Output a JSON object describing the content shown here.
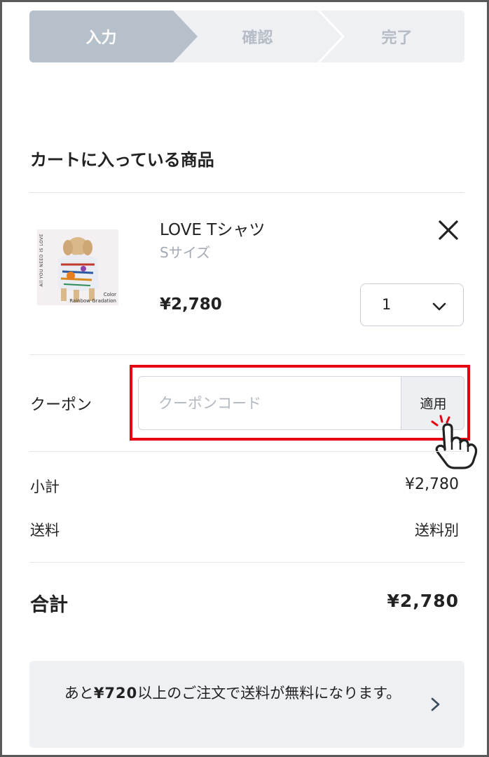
{
  "stepper": {
    "steps": [
      {
        "label": "入力",
        "active": true
      },
      {
        "label": "確認",
        "active": false
      },
      {
        "label": "完了",
        "active": false
      }
    ],
    "active_color": "#b6c0cb",
    "inactive_color": "#eef0f3"
  },
  "cart": {
    "title": "カートに入っている商品",
    "item": {
      "name": "LOVE Tシャツ",
      "size": "Sサイズ",
      "price": "¥2,780",
      "quantity": "1",
      "thumbnail": {
        "vertical_text": "All YOU NEED IS LOVE",
        "caption_line1": "Color",
        "caption_line2": "Rainbow Gradation"
      },
      "remove_icon": "close-icon"
    }
  },
  "coupon": {
    "label": "クーポン",
    "placeholder": "クーポンコード",
    "apply_label": "適用",
    "highlight_color": "#e60012"
  },
  "totals": {
    "subtotal_label": "小計",
    "subtotal_value": "¥2,780",
    "shipping_label": "送料",
    "shipping_value": "送料別",
    "total_label": "合計",
    "total_value": "¥2,780"
  },
  "notice": {
    "text_before": "あと",
    "amount": "¥720",
    "text_after": "以上のご注文で送料が無料になります。",
    "icon": "chevron-right-icon"
  }
}
